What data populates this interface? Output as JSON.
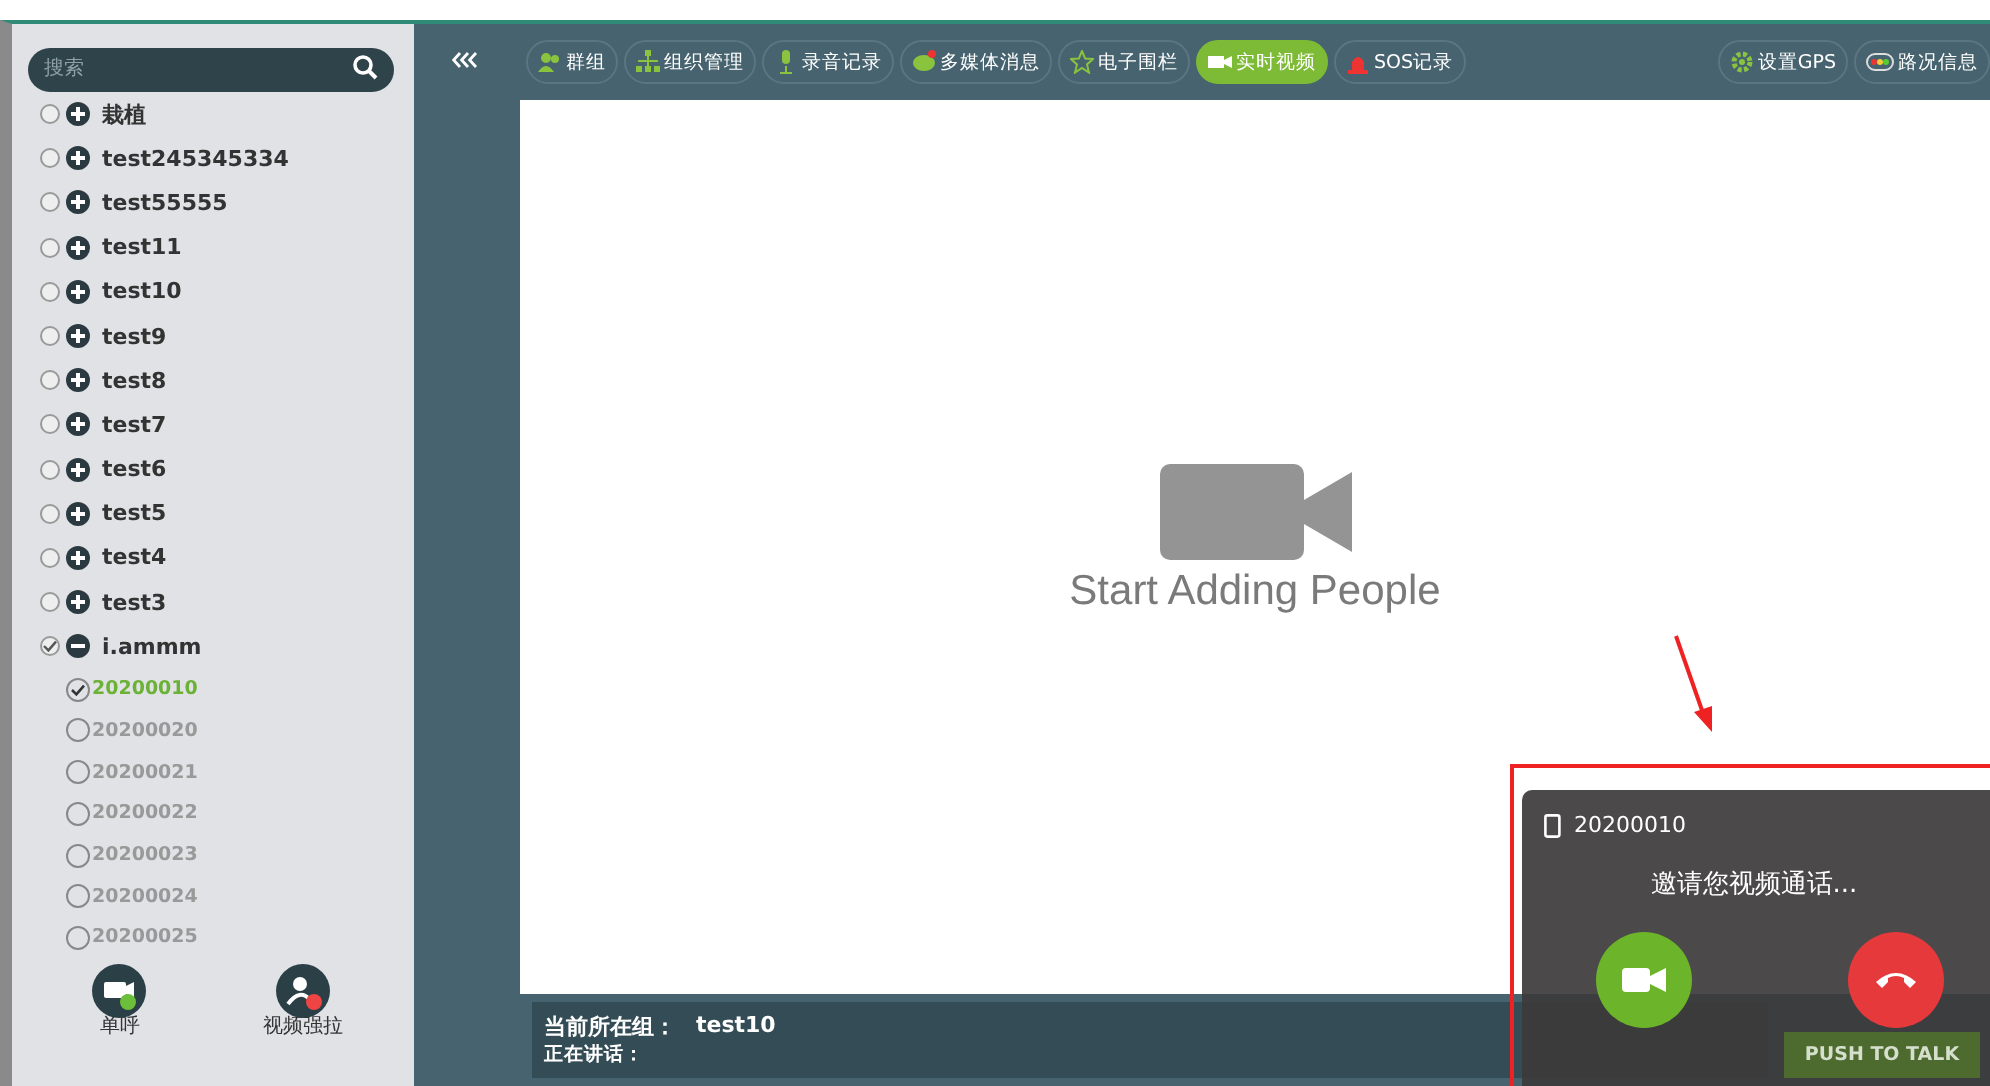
{
  "sidebar": {
    "search": {
      "placeholder": "搜索"
    },
    "tree": [
      {
        "label": "栽植",
        "checked": false,
        "expanded": false
      },
      {
        "label": "test245345334",
        "checked": false,
        "expanded": false
      },
      {
        "label": "test55555",
        "checked": false,
        "expanded": false
      },
      {
        "label": "test11",
        "checked": false,
        "expanded": false
      },
      {
        "label": "test10",
        "checked": false,
        "expanded": false
      },
      {
        "label": "test9",
        "checked": false,
        "expanded": false
      },
      {
        "label": "test8",
        "checked": false,
        "expanded": false
      },
      {
        "label": "test7",
        "checked": false,
        "expanded": false
      },
      {
        "label": "test6",
        "checked": false,
        "expanded": false
      },
      {
        "label": "test5",
        "checked": false,
        "expanded": false
      },
      {
        "label": "test4",
        "checked": false,
        "expanded": false
      },
      {
        "label": "test3",
        "checked": false,
        "expanded": false
      },
      {
        "label": "i.ammm",
        "checked": true,
        "expanded": true,
        "children": [
          {
            "label": "20200010",
            "checked": true
          },
          {
            "label": "20200020",
            "checked": false
          },
          {
            "label": "20200021",
            "checked": false
          },
          {
            "label": "20200022",
            "checked": false
          },
          {
            "label": "20200023",
            "checked": false
          },
          {
            "label": "20200024",
            "checked": false
          },
          {
            "label": "20200025",
            "checked": false
          }
        ]
      }
    ],
    "actions": [
      {
        "label": "单呼"
      },
      {
        "label": "视频强拉"
      }
    ]
  },
  "toolbar": {
    "left": [
      {
        "label": "群组",
        "selected": false
      },
      {
        "label": "组织管理",
        "selected": false
      },
      {
        "label": "录音记录",
        "selected": false
      },
      {
        "label": "多媒体消息",
        "selected": false
      },
      {
        "label": "电子围栏",
        "selected": false
      },
      {
        "label": "实时视频",
        "selected": true
      },
      {
        "label": "SOS记录",
        "selected": false
      }
    ],
    "right": [
      {
        "label": "设置GPS",
        "selected": false
      },
      {
        "label": "路况信息",
        "selected": false
      }
    ]
  },
  "video": {
    "empty_text": "Start Adding People"
  },
  "status": {
    "group_label": "当前所在组：",
    "group_value": "test10",
    "speaking_label": "正在讲话：",
    "ptt_button": "PUSH TO TALK"
  },
  "call_popup": {
    "caller": "20200010",
    "message": "邀请您视频通话..."
  }
}
